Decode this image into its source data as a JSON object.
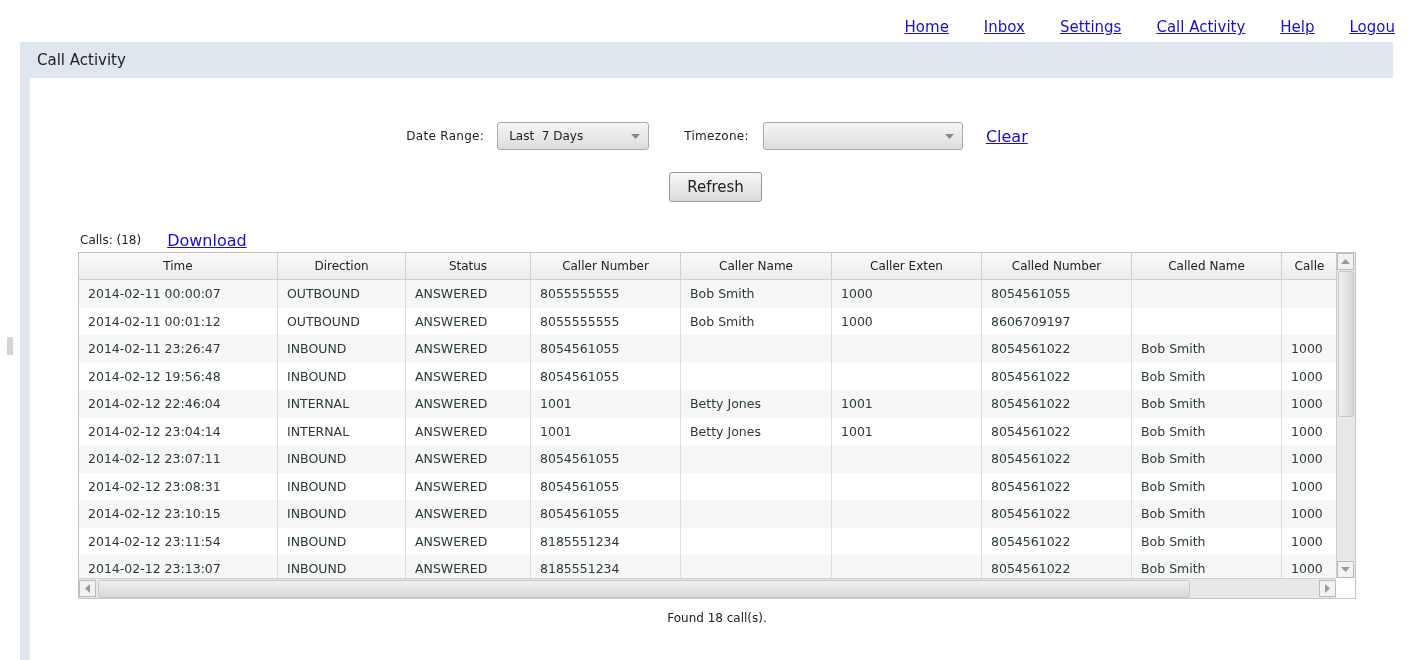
{
  "nav": [
    "Home",
    "Inbox",
    "Settings",
    "Call Activity",
    "Help",
    "Logou"
  ],
  "panel": {
    "title": "Call Activity"
  },
  "filters": {
    "date_range_label": "Date Range:",
    "date_range_value": "Last  7 Days",
    "timezone_label": "Timezone:",
    "clear_link": "Clear",
    "refresh_button": "Refresh"
  },
  "calls_count": "Calls: (18)",
  "download_link": "Download",
  "table": {
    "columns": [
      "Time",
      "Direction",
      "Status",
      "Caller Number",
      "Caller Name",
      "Caller Exten",
      "Called Number",
      "Called Name",
      "Calle"
    ],
    "rows": [
      [
        "2014-02-11 00:00:07",
        "OUTBOUND",
        "ANSWERED",
        "8055555555",
        "Bob Smith",
        "1000",
        "8054561055",
        "",
        ""
      ],
      [
        "2014-02-11 00:01:12",
        "OUTBOUND",
        "ANSWERED",
        "8055555555",
        "Bob Smith",
        "1000",
        "8606709197",
        "",
        ""
      ],
      [
        "2014-02-11 23:26:47",
        "INBOUND",
        "ANSWERED",
        "8054561055",
        "",
        "",
        "8054561022",
        "Bob Smith",
        "1000"
      ],
      [
        "2014-02-12 19:56:48",
        "INBOUND",
        "ANSWERED",
        "8054561055",
        "",
        "",
        "8054561022",
        "Bob Smith",
        "1000"
      ],
      [
        "2014-02-12 22:46:04",
        "INTERNAL",
        "ANSWERED",
        "1001",
        "Betty Jones",
        "1001",
        "8054561022",
        "Bob Smith",
        "1000"
      ],
      [
        "2014-02-12 23:04:14",
        "INTERNAL",
        "ANSWERED",
        "1001",
        "Betty Jones",
        "1001",
        "8054561022",
        "Bob Smith",
        "1000"
      ],
      [
        "2014-02-12 23:07:11",
        "INBOUND",
        "ANSWERED",
        "8054561055",
        "",
        "",
        "8054561022",
        "Bob Smith",
        "1000"
      ],
      [
        "2014-02-12 23:08:31",
        "INBOUND",
        "ANSWERED",
        "8054561055",
        "",
        "",
        "8054561022",
        "Bob Smith",
        "1000"
      ],
      [
        "2014-02-12 23:10:15",
        "INBOUND",
        "ANSWERED",
        "8054561055",
        "",
        "",
        "8054561022",
        "Bob Smith",
        "1000"
      ],
      [
        "2014-02-12 23:11:54",
        "INBOUND",
        "ANSWERED",
        "8185551234",
        "",
        "",
        "8054561022",
        "Bob Smith",
        "1000"
      ],
      [
        "2014-02-12 23:13:07",
        "INBOUND",
        "ANSWERED",
        "8185551234",
        "",
        "",
        "8054561022",
        "Bob Smith",
        "1000"
      ]
    ]
  },
  "footer": "Found 18 call(s)."
}
